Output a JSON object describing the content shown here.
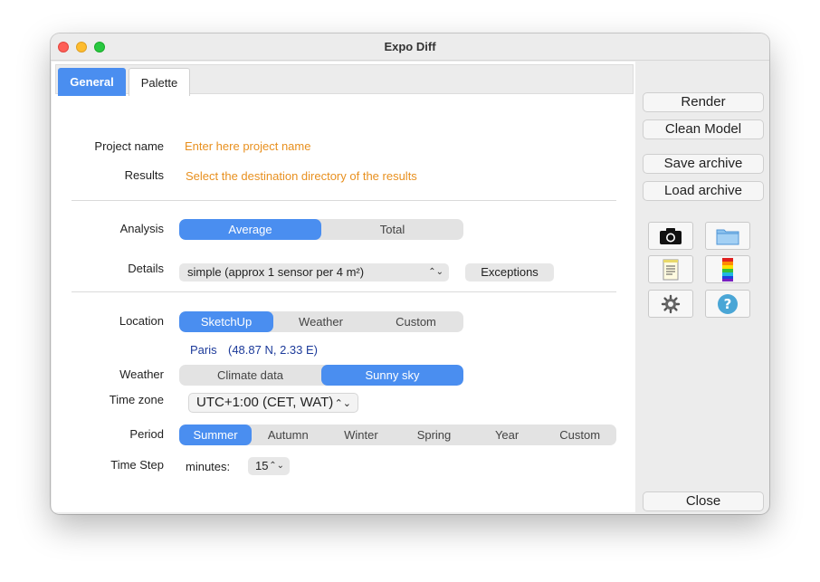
{
  "window": {
    "title": "Expo Diff"
  },
  "tabs": [
    {
      "label": "General"
    },
    {
      "label": "Palette"
    }
  ],
  "general": {
    "project_name_label": "Project name",
    "project_name_placeholder": "Enter here project name",
    "results_label": "Results",
    "results_placeholder": "Select the destination directory of the results",
    "analysis_label": "Analysis",
    "analysis_options": [
      "Average",
      "Total"
    ],
    "analysis_selected": "Average",
    "details_label": "Details",
    "details_value": "simple (approx 1 sensor per 4 m²)",
    "exceptions_label": "Exceptions",
    "location_label": "Location",
    "location_options": [
      "SketchUp",
      "Weather",
      "Custom"
    ],
    "location_selected": "SketchUp",
    "location_city": "Paris",
    "location_coords": "(48.87 N, 2.33 E)",
    "weather_label": "Weather",
    "weather_options": [
      "Climate data",
      "Sunny sky"
    ],
    "weather_selected": "Sunny sky",
    "timezone_label": "Time zone",
    "timezone_value": "UTC+1:00 (CET, WAT)",
    "period_label": "Period",
    "period_options": [
      "Summer",
      "Autumn",
      "Winter",
      "Spring",
      "Year",
      "Custom"
    ],
    "period_selected": "Summer",
    "timestep_label": "Time Step",
    "minutes_label": "minutes:",
    "minutes_value": "15"
  },
  "sidebar": {
    "render": "Render",
    "clean_model": "Clean Model",
    "save_archive": "Save archive",
    "load_archive": "Load archive",
    "close": "Close",
    "icons": [
      "camera-icon",
      "folder-icon",
      "notes-icon",
      "color-scale-icon",
      "gear-icon",
      "help-icon"
    ]
  },
  "colors": {
    "accent": "#4a8ef0",
    "placeholder": "#e8901f",
    "location_text": "#1c3a9a",
    "help": "#4aa6d6"
  }
}
